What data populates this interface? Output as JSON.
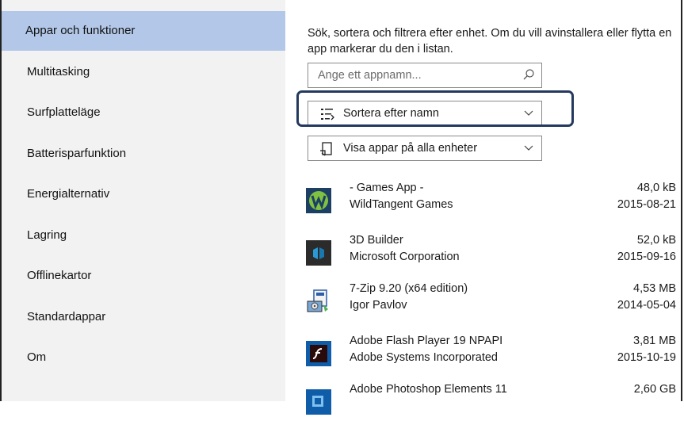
{
  "sidebar": {
    "items": [
      {
        "label": "Appar och funktioner",
        "selected": true
      },
      {
        "label": "Multitasking"
      },
      {
        "label": "Surfplatteläge"
      },
      {
        "label": "Batterisparfunktion"
      },
      {
        "label": "Energialternativ"
      },
      {
        "label": "Lagring"
      },
      {
        "label": "Offlinekartor"
      },
      {
        "label": "Standardappar"
      },
      {
        "label": "Om"
      }
    ]
  },
  "main": {
    "description": "Sök, sortera och filtrera efter enhet. Om du vill avinstallera eller flytta en app markerar du den i listan.",
    "search": {
      "placeholder": "Ange ett appnamn..."
    },
    "sort": {
      "label": "Sortera efter namn"
    },
    "filter": {
      "label": "Visa appar på alla enheter"
    },
    "apps": [
      {
        "name": "- Games App -",
        "publisher": "WildTangent Games",
        "size": "48,0 kB",
        "date": "2015-08-21",
        "icon": "wildtangent-icon"
      },
      {
        "name": "3D Builder",
        "publisher": "Microsoft Corporation",
        "size": "52,0 kB",
        "date": "2015-09-16",
        "icon": "3d-builder-icon"
      },
      {
        "name": "7-Zip 9.20 (x64 edition)",
        "publisher": "Igor Pavlov",
        "size": "4,53 MB",
        "date": "2014-05-04",
        "icon": "installer-icon"
      },
      {
        "name": "Adobe Flash Player 19 NPAPI",
        "publisher": "Adobe Systems Incorporated",
        "size": "3,81 MB",
        "date": "2015-10-19",
        "icon": "flash-player-icon"
      },
      {
        "name": "Adobe Photoshop Elements 11",
        "publisher": "",
        "size": "2,60 GB",
        "date": "",
        "icon": "photoshop-elements-icon"
      }
    ]
  },
  "colors": {
    "selected_nav": "#b3c8e8",
    "highlight_border": "#24395e",
    "sidebar_bg": "#f2f2f2"
  }
}
